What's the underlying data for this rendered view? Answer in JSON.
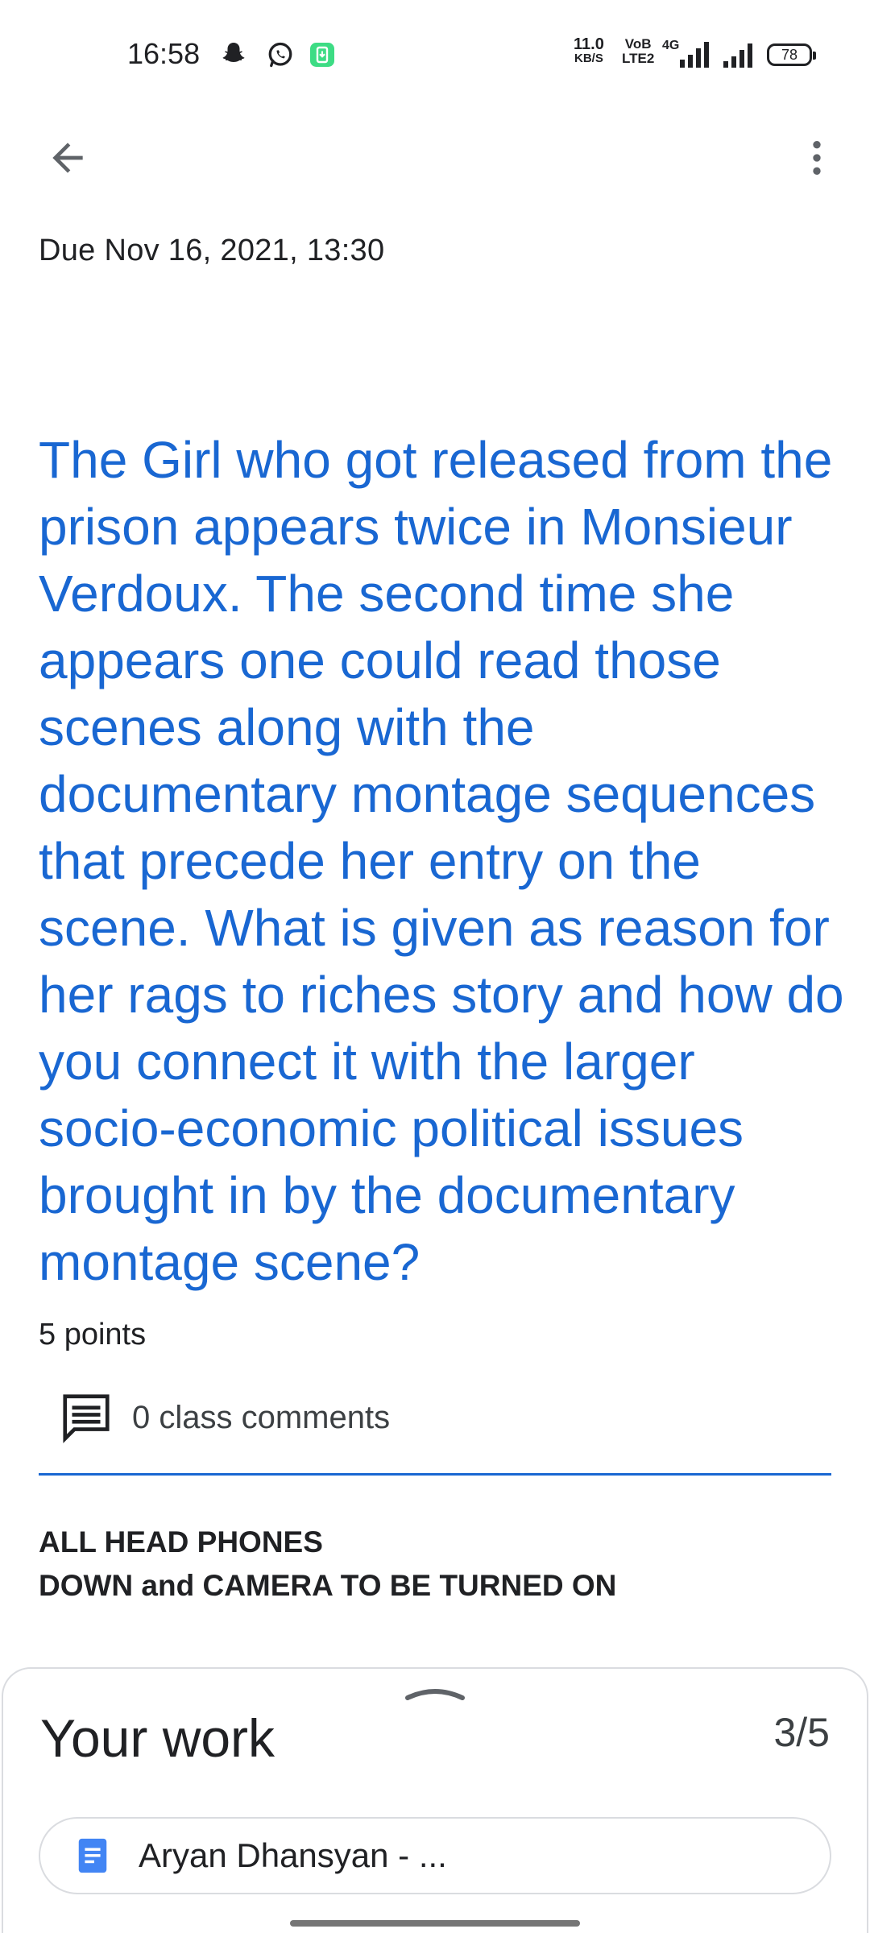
{
  "status_bar": {
    "time": "16:58",
    "net_speed_value": "11.0",
    "net_speed_unit": "KB/S",
    "volte_top": "VoB",
    "volte_bottom": "LTE2",
    "network_label": "4G",
    "battery": "78",
    "icons": [
      "snapchat-icon",
      "whatsapp-icon",
      "app-notification-icon",
      "signal-icon",
      "signal-icon-2"
    ]
  },
  "header": {
    "back_icon": "arrow-back-icon",
    "more_icon": "more-vert-icon"
  },
  "assignment": {
    "due": "Due Nov 16, 2021, 13:30",
    "title": "The Girl who got released from the prison appears twice in Monsieur Verdoux. The second time she appears one could read those scenes along with the documentary montage sequences that precede her entry on the scene. What is given as reason for her rags to riches story and how do you connect it with the larger socio-economic political issues brought in by the documentary montage scene?",
    "points": "5 points",
    "comments_label": "0 class comments",
    "instructions_line1": "ALL HEAD PHONES",
    "instructions_line2": "DOWN and CAMERA TO BE TURNED ON"
  },
  "your_work": {
    "title": "Your work",
    "count": "3/5",
    "attachment_label": "Aryan Dhansyan - ...",
    "attachment_icon": "google-docs-icon"
  },
  "colors": {
    "accent": "#1967d2",
    "text": "#202124",
    "docs_blue": "#4285f4",
    "whatsapp_green": "#25d366"
  }
}
